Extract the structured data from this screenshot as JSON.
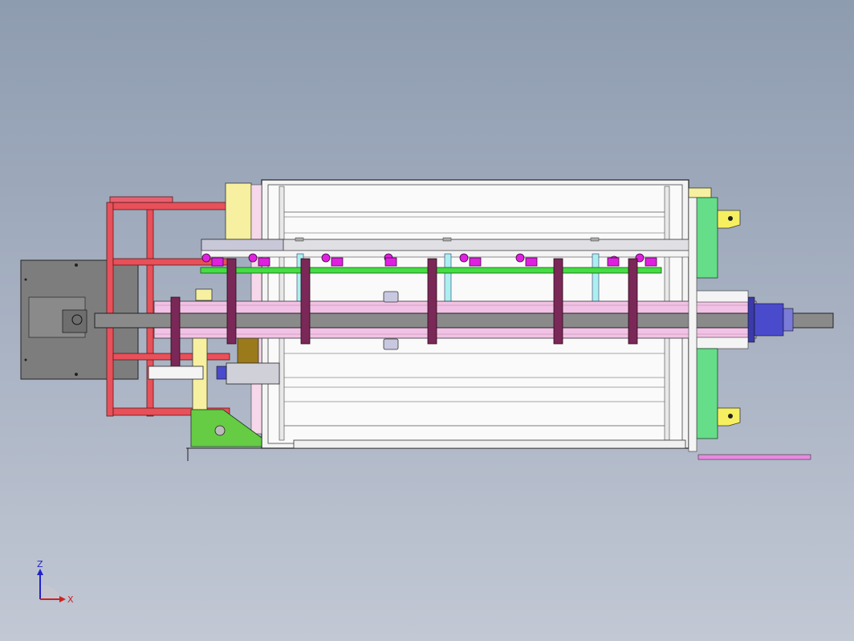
{
  "viewport": {
    "background_top": "#8e9cb0",
    "background_bottom": "#c2c8d4"
  },
  "triad": {
    "z_label": "Z",
    "x_label": "X",
    "z_color": "#2222cc",
    "x_color": "#cc2222"
  },
  "colors": {
    "frame_red": "#e8505a",
    "gray_plate": "#7a7a7a",
    "yellow": "#f6f0a0",
    "pink": "#f2c2e6",
    "green_bar": "#44dd44",
    "magenta": "#e020e0",
    "maroon": "#7a2858",
    "green_plate": "#66dd88",
    "outline": "#1a1a1a"
  }
}
